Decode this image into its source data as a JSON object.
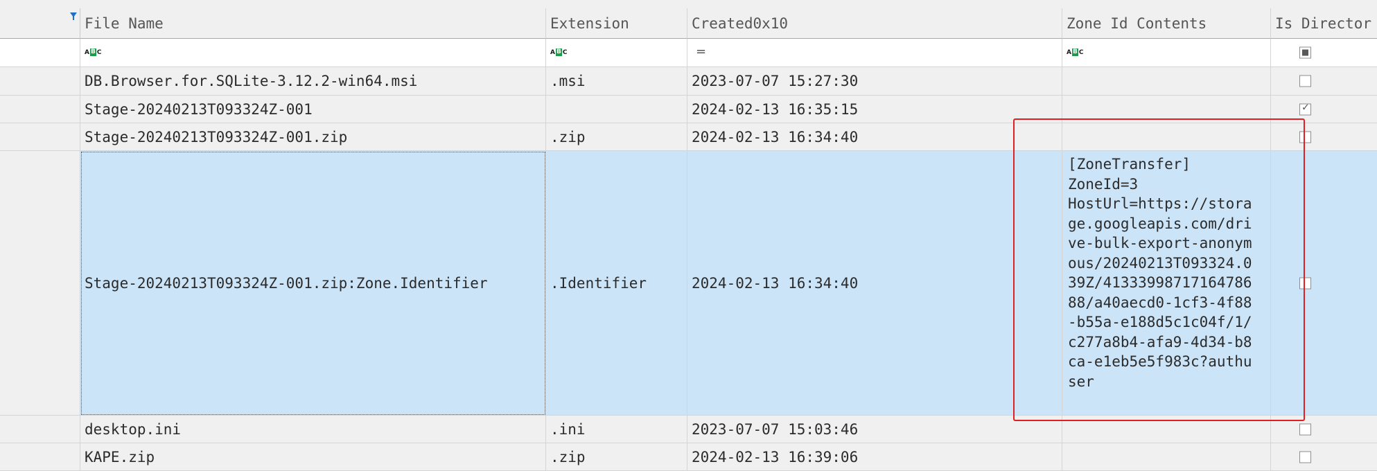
{
  "columns": {
    "file_name": "File Name",
    "extension": "Extension",
    "created": "Created0x10",
    "zone": "Zone Id Contents",
    "is_dir": "Is Director"
  },
  "filter_row": {
    "equals_symbol": "="
  },
  "rows": [
    {
      "file_name": "DB.Browser.for.SQLite-3.12.2-win64.msi",
      "extension": ".msi",
      "created": "2023-07-07 15:27:30",
      "zone": "",
      "is_dir": false
    },
    {
      "file_name": "Stage-20240213T093324Z-001",
      "extension": "",
      "created": "2024-02-13 16:35:15",
      "zone": "",
      "is_dir": true
    },
    {
      "file_name": "Stage-20240213T093324Z-001.zip",
      "extension": ".zip",
      "created": "2024-02-13 16:34:40",
      "zone": "",
      "is_dir": false
    },
    {
      "file_name": "Stage-20240213T093324Z-001.zip:Zone.Identifier",
      "extension": ".Identifier",
      "created": "2024-02-13 16:34:40",
      "zone": "[ZoneTransfer]\nZoneId=3\nHostUrl=https://stora\nge.googleapis.com/dri\nve-bulk-export-anonym\nous/20240213T093324.0\n39Z/41333998717164786\n88/a40aecd0-1cf3-4f88\n-b55a-e188d5c1c04f/1/\nc277a8b4-afa9-4d34-b8\nca-e1eb5e5f983c?authu\nser",
      "is_dir": false,
      "selected": true
    },
    {
      "file_name": "desktop.ini",
      "extension": ".ini",
      "created": "2023-07-07 15:03:46",
      "zone": "",
      "is_dir": false
    },
    {
      "file_name": "KAPE.zip",
      "extension": ".zip",
      "created": "2024-02-13 16:39:06",
      "zone": "",
      "is_dir": false
    }
  ],
  "colors": {
    "selection": "#cce4f7",
    "highlight_box": "#e02020",
    "abc_green": "#1d9a4a"
  }
}
